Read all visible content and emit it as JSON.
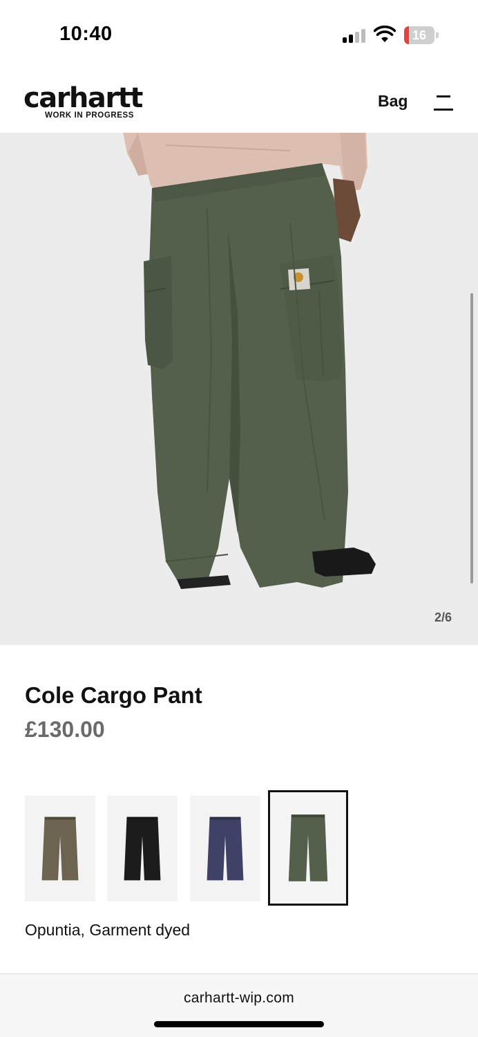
{
  "status_bar": {
    "time": "10:40",
    "battery_level": "16",
    "battery_color": "#e8403a",
    "signal_bars_active": 2,
    "icons": [
      "signal-icon",
      "wifi-icon",
      "battery-icon"
    ]
  },
  "header": {
    "logo_word": "carhartt",
    "logo_tagline": "WORK IN PROGRESS",
    "bag_label": "Bag",
    "menu_icon": "hamburger-menu-icon"
  },
  "gallery": {
    "counter": "2/6",
    "background": "#ececec",
    "pant_color": "#545f4c",
    "shirt_color": "#dcbfb0"
  },
  "product": {
    "title": "Cole Cargo Pant",
    "price": "£130.00",
    "color_name": "Opuntia, Garment dyed"
  },
  "swatches": [
    {
      "color": "#6c6350",
      "selected": false
    },
    {
      "color": "#1c1c1c",
      "selected": false
    },
    {
      "color": "#3f4266",
      "selected": false
    },
    {
      "color": "#545f4c",
      "selected": true
    }
  ],
  "browser": {
    "url": "carhartt-wip.com"
  }
}
